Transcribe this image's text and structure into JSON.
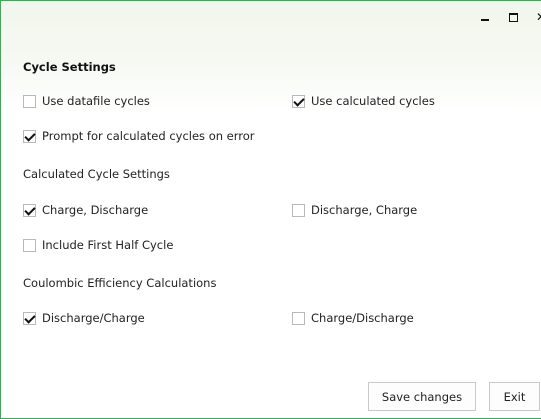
{
  "window": {
    "controls": {
      "minimize_icon": "minimize-icon",
      "maximize_icon": "maximize-icon",
      "close_icon": "close-icon"
    }
  },
  "section": {
    "title": "Cycle Settings"
  },
  "cycles": {
    "use_datafile": {
      "label": "Use datafile cycles",
      "checked": false
    },
    "use_calculated": {
      "label": "Use calculated cycles",
      "checked": true
    },
    "prompt_on_error": {
      "label": "Prompt for calculated cycles on error",
      "checked": true
    }
  },
  "calculated": {
    "heading": "Calculated Cycle Settings",
    "charge_discharge": {
      "label": "Charge, Discharge",
      "checked": true
    },
    "discharge_charge": {
      "label": "Discharge, Charge",
      "checked": false
    },
    "include_first_half": {
      "label": "Include First Half Cycle",
      "checked": false
    }
  },
  "coulombic": {
    "heading": "Coulombic Efficiency Calculations",
    "discharge_over_charge": {
      "label": "Discharge/Charge",
      "checked": true
    },
    "charge_over_discharge": {
      "label": "Charge/Discharge",
      "checked": false
    }
  },
  "buttons": {
    "save": "Save changes",
    "exit": "Exit"
  },
  "colors": {
    "border": "#2eb24b"
  }
}
